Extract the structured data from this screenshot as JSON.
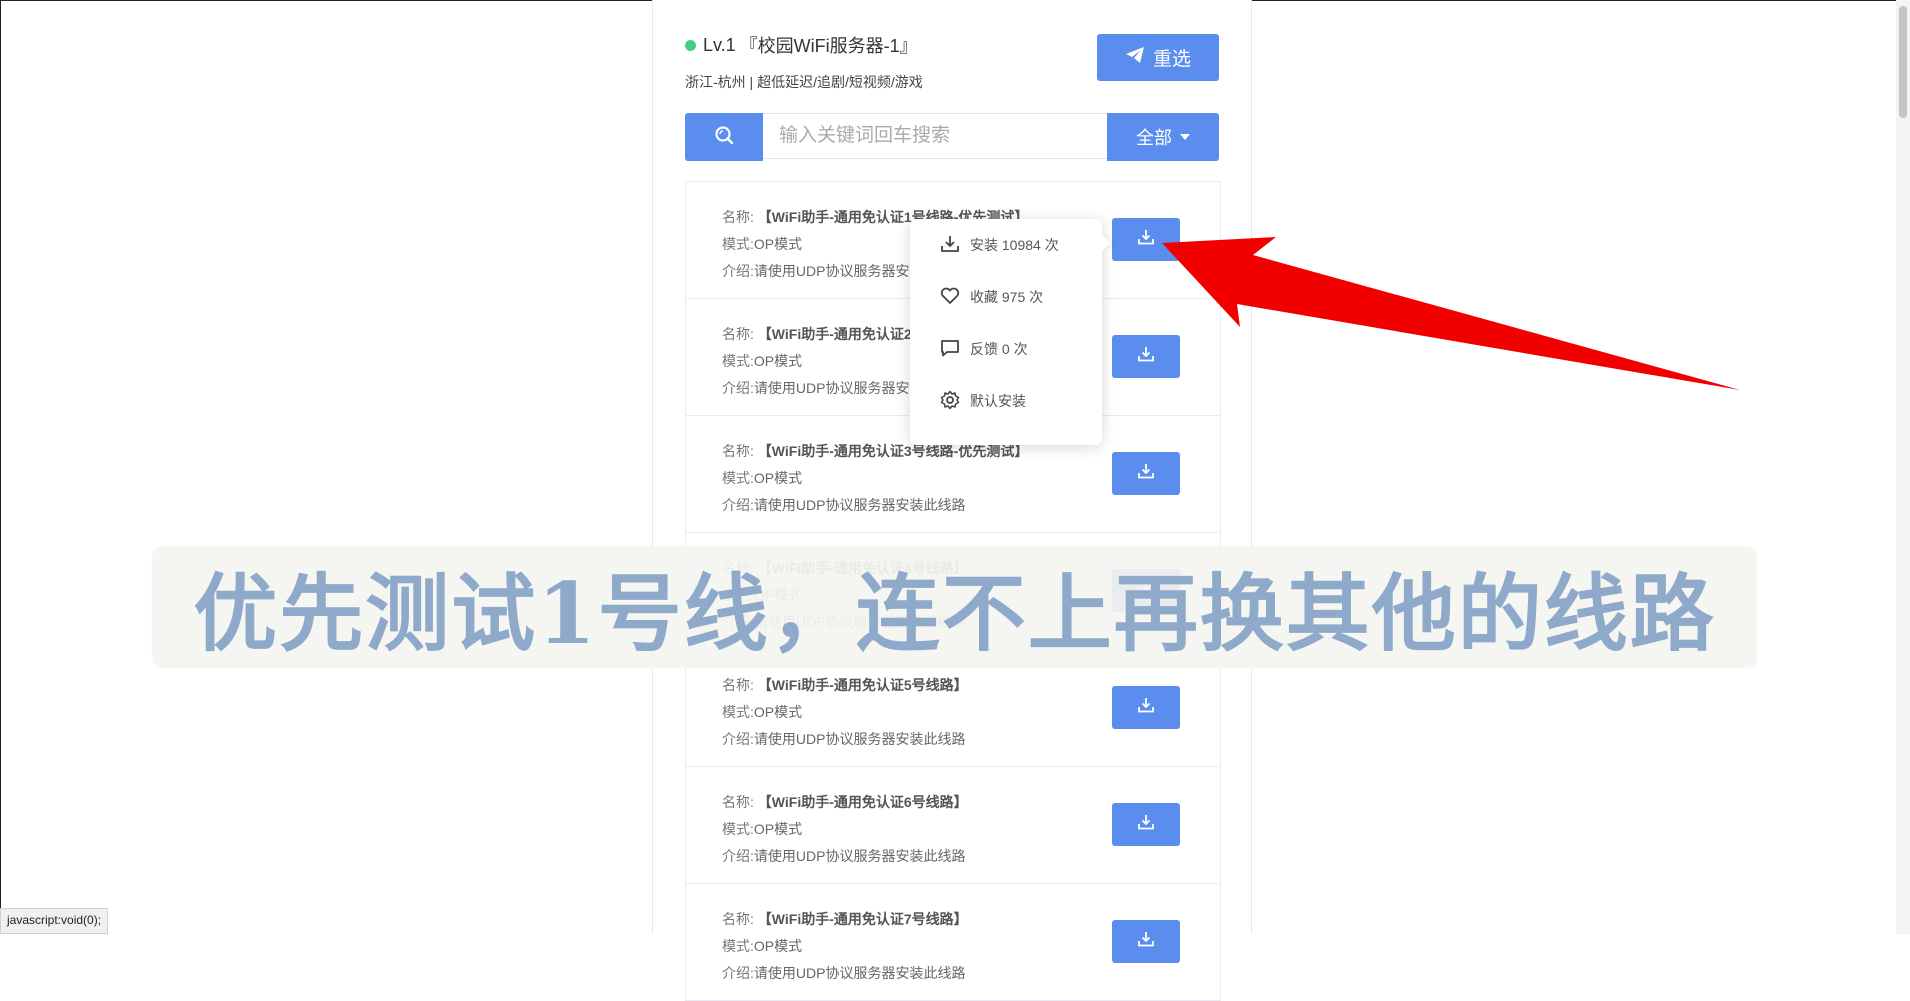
{
  "server": {
    "level": "Lv.1",
    "title": "『校园WiFi服务器-1』",
    "subtitle": "浙江-杭州 | 超低延迟/追剧/短视频/游戏",
    "reselect_label": "重选",
    "status_color": "#43d17f"
  },
  "search": {
    "placeholder": "输入关键词回车搜索",
    "filter_label": "全部",
    "icon": "search-icon"
  },
  "labels": {
    "name": "名称:",
    "mode": "模式:",
    "intro": "介绍:"
  },
  "lines": [
    {
      "name": "【WiFi助手-通用免认证1号线路-优先测试】",
      "mode": "OP模式",
      "intro": "请使用UDP协议服务器安装此线路"
    },
    {
      "name": "【WiFi助手-通用免认证2号线路-优先测试】",
      "mode": "OP模式",
      "intro": "请使用UDP协议服务器安装此线路"
    },
    {
      "name": "【WiFi助手-通用免认证3号线路-优先测试】",
      "mode": "OP模式",
      "intro": "请使用UDP协议服务器安装此线路"
    },
    {
      "name": "【WiFi助手-通用免认证4号线路】",
      "mode": "OP模式",
      "intro": "请使用UDP协议服务器安装此线路"
    },
    {
      "name": "【WiFi助手-通用免认证5号线路】",
      "mode": "OP模式",
      "intro": "请使用UDP协议服务器安装此线路"
    },
    {
      "name": "【WiFi助手-通用免认证6号线路】",
      "mode": "OP模式",
      "intro": "请使用UDP协议服务器安装此线路"
    },
    {
      "name": "【WiFi助手-通用免认证7号线路】",
      "mode": "OP模式",
      "intro": "请使用UDP协议服务器安装此线路"
    }
  ],
  "dropdown": {
    "items": [
      {
        "label": "安装 10984 次",
        "icon": "download-icon"
      },
      {
        "label": "收藏 975 次",
        "icon": "heart-icon"
      },
      {
        "label": "反馈 0 次",
        "icon": "comment-icon"
      },
      {
        "label": "默认安装",
        "icon": "gear-icon"
      }
    ]
  },
  "overlay": {
    "text": "优先测试1号线，连不上再换其他的线路"
  },
  "status_bar": {
    "text": "javascript:void(0);"
  },
  "colors": {
    "accent": "#5b8def",
    "arrow": "#f20000",
    "overlay_text": "#8ea9c9"
  }
}
